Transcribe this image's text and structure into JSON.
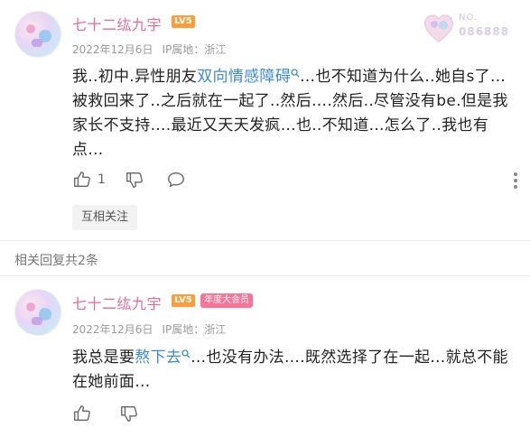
{
  "comments": [
    {
      "username": "七十二纮九宇",
      "level": "LV5",
      "vip": "",
      "date": "2022年12月6日",
      "ip": "IP属地：浙江",
      "text_before_link": "我..初中.异性朋友",
      "link": "双向情感障碍",
      "text_after_link": "…也不知道为什么..她自s了…被救回来了..之后就在一起了..然后….然后..尽管没有be.但是我家长不支持….最近又天天发疯…也..不知道…怎么了..我也有点…",
      "like_count": "1",
      "tag_button": "互相关注",
      "nft": {
        "no_label": "NO.",
        "number": "086888"
      }
    },
    {
      "username": "七十二纮九宇",
      "level": "LV5",
      "vip": "年度大会员",
      "date": "2022年12月6日",
      "ip": "IP属地：浙江",
      "text_before_link": "我总是要",
      "link": "熬下去",
      "text_after_link": "…也没有办法….既然选择了在一起…就总不能在她前面…",
      "like_count": ""
    }
  ],
  "replies_label": "相关回复共2条",
  "icons": [
    "thumb-up-icon",
    "thumb-down-icon",
    "comment-icon",
    "more-icon",
    "search-icon",
    "heart-badge-icon"
  ],
  "colors": {
    "username": "#e26a9a",
    "link": "#3d8bd6",
    "level": "#ff9d3a",
    "vip": "#fb7299"
  }
}
